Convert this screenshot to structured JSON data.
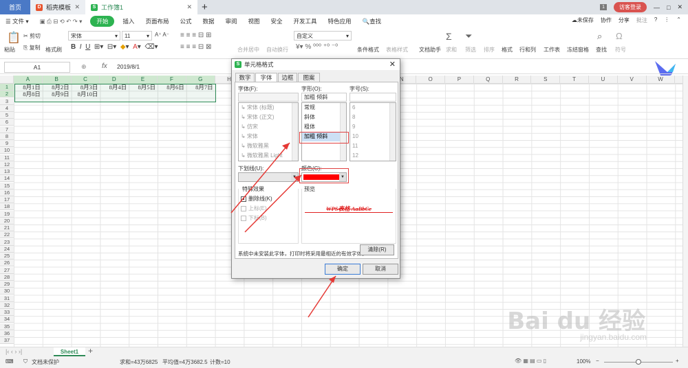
{
  "tabs": {
    "home": "首页",
    "template": "稻壳模板",
    "workbook": "工作簿1",
    "page_badge": "1",
    "login": "访客登录"
  },
  "menu": {
    "file": "文件",
    "start": "开始",
    "items": [
      "插入",
      "页面布局",
      "公式",
      "数据",
      "审阅",
      "视图",
      "安全",
      "开发工具",
      "特色应用"
    ],
    "search": "查找",
    "unsaved": "未保存",
    "collab": "协作",
    "share": "分享",
    "comment": "批注"
  },
  "toolbar": {
    "paste": "粘贴",
    "cut": "剪切",
    "copy": "复制",
    "format_painter": "格式刷",
    "font": "宋体",
    "size": "11",
    "merge": "合并居中",
    "wrap": "自动换行",
    "numfmt": "自定义",
    "cond": "条件格式",
    "tablestyle": "表格样式",
    "docassist": "文档助手",
    "sum": "求和",
    "filter": "筛选",
    "sort": "排序",
    "format": "格式",
    "rowcol": "行和列",
    "sheet": "工作表",
    "freeze": "冻结窗格",
    "find": "查找",
    "symbol": "符号"
  },
  "formula": {
    "cellref": "A1",
    "fx": "fx",
    "value": "2019/8/1"
  },
  "columns": [
    "A",
    "B",
    "C",
    "D",
    "E",
    "F",
    "G",
    "H",
    "I",
    "J",
    "K",
    "L",
    "M",
    "N",
    "O",
    "P",
    "Q",
    "R",
    "S",
    "T",
    "U",
    "V",
    "W",
    "X"
  ],
  "rows": [
    "1",
    "2",
    "3",
    "4",
    "5",
    "6",
    "7",
    "8",
    "9",
    "10",
    "11",
    "12",
    "13",
    "14",
    "15",
    "16",
    "17",
    "18",
    "19",
    "20",
    "21",
    "22",
    "23",
    "24",
    "25",
    "26",
    "27",
    "28",
    "29",
    "30",
    "31",
    "32",
    "33",
    "34",
    "35",
    "36",
    "37"
  ],
  "cells": {
    "r1": [
      "8月1日",
      "8月2日",
      "8月3日",
      "8月4日",
      "8月5日",
      "8月6日",
      "8月7日"
    ],
    "r2": [
      "8月8日",
      "8月9日",
      "8月10日"
    ]
  },
  "sheet": {
    "name": "Sheet1"
  },
  "status": {
    "protect": "文档未保护",
    "sum": "求和=43万6825",
    "avg": "平均值=4万3682.5",
    "count": "计数=10",
    "zoom": "100%"
  },
  "dialog": {
    "title": "单元格格式",
    "tabs": [
      "数字",
      "字体",
      "边框",
      "图案"
    ],
    "font_label": "字体(F):",
    "style_label": "字形(O):",
    "size_label": "字号(S):",
    "style_value": "加粗 倾斜",
    "fonts": [
      "宋体 (标题)",
      "宋体 (正文)",
      "仿宋",
      "宋体",
      "微软雅黑",
      "微软雅黑 Light"
    ],
    "styles": [
      "常规",
      "斜体",
      "粗体",
      "加粗 倾斜"
    ],
    "sizes": [
      "6",
      "8",
      "9",
      "10",
      "11",
      "12"
    ],
    "underline_label": "下划线(U):",
    "color_label": "颜色(C):",
    "effects_label": "特殊效果",
    "strike": "删除线(K)",
    "super": "上标(E)",
    "sub": "下标(B)",
    "preview_label": "预览",
    "preview_text": "WPS表格  AaBbCc",
    "note": "系统中未安装此字体，打印时将采用最相近的有效字体。",
    "clear": "清除(R)",
    "ok": "确定",
    "cancel": "取消",
    "color_value": "#ff0000"
  },
  "watermark": {
    "main": "Bai du 经验",
    "sub": "jingyan.baidu.com"
  }
}
